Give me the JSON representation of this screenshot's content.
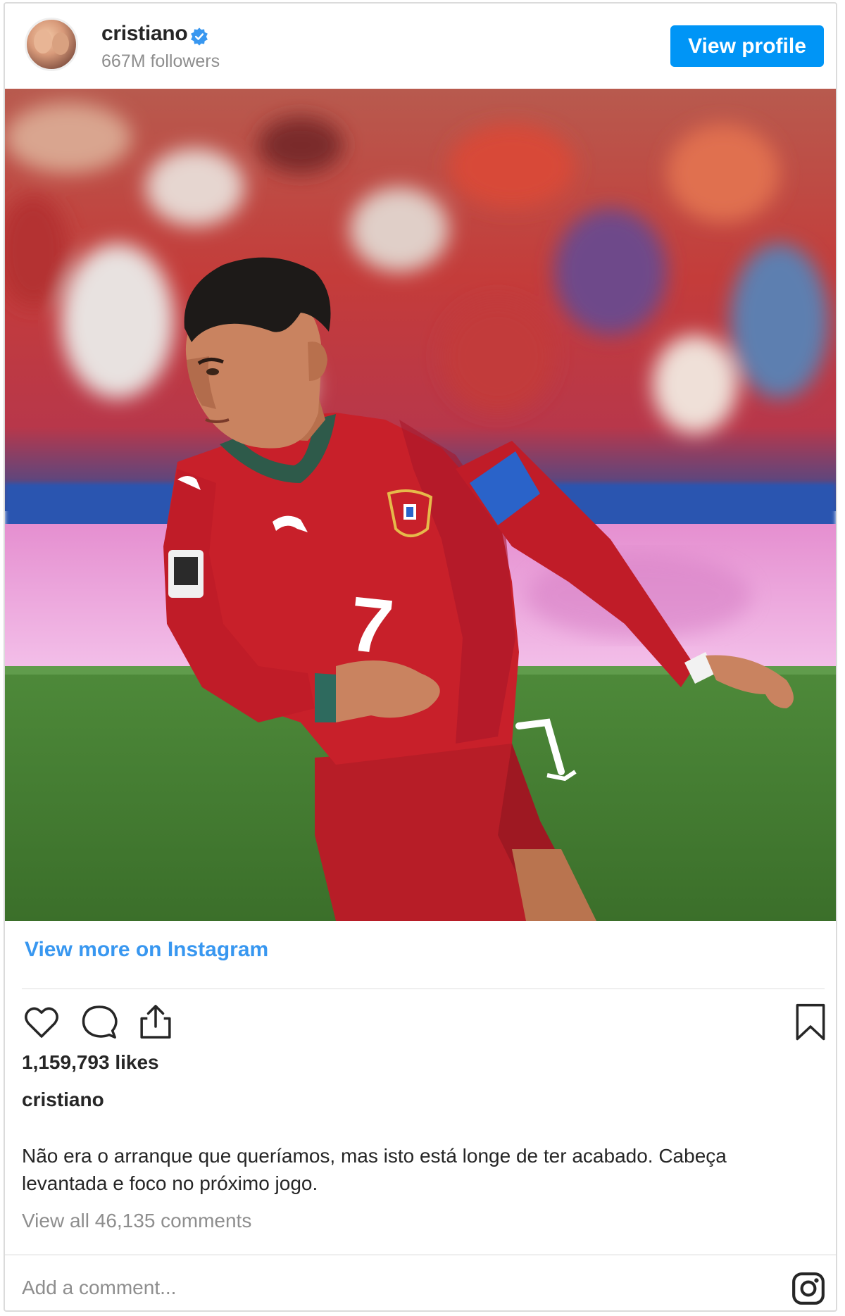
{
  "header": {
    "username": "cristiano",
    "followers": "667M followers",
    "view_profile_label": "View profile",
    "verified_icon": "verified-badge-icon"
  },
  "post": {
    "image_description_icon": "photo",
    "view_more_label": "View more on Instagram",
    "likes": "1,159,793 likes",
    "caption_user": "cristiano",
    "caption": "Não era o arranque que queríamos, mas isto está longe de ter acabado. Cabeça levantada e foco no próximo jogo.",
    "comments_link": "View all 46,135 comments",
    "add_comment_placeholder": "Add a comment...",
    "jersey_number": "7"
  },
  "icons": {
    "like": "heart-icon",
    "comment": "comment-icon",
    "share": "share-icon",
    "save": "bookmark-icon",
    "instagram": "instagram-icon"
  },
  "colors": {
    "accent": "#0095f6",
    "link": "#3897f0",
    "muted": "#8e8e8e",
    "text": "#262626",
    "jersey": "#c8202a"
  }
}
